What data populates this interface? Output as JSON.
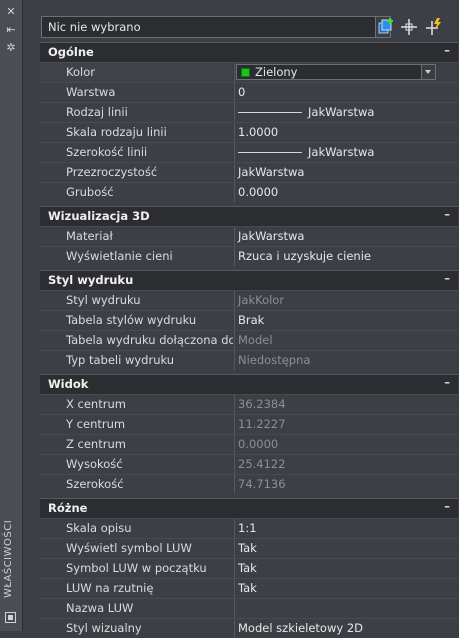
{
  "palette_title": "WŁAŚCIWOŚCI",
  "selector": {
    "value": "Nic nie wybrano"
  },
  "toolbar": {
    "icons": [
      "toggle-pickadd-icon",
      "select-objects-icon",
      "quick-select-icon"
    ]
  },
  "sections": {
    "general": {
      "title": "Ogólne",
      "toggle": "–",
      "color_label": "Kolor",
      "color_value": "Zielony",
      "color_hex": "#18c418",
      "layer_label": "Warstwa",
      "layer_value": "0",
      "linetype_label": "Rodzaj linii",
      "linetype_value": "JakWarstwa",
      "ltscale_label": "Skala rodzaju linii",
      "ltscale_value": "1.0000",
      "lineweight_label": "Szerokość linii",
      "lineweight_value": "JakWarstwa",
      "transparency_label": "Przezroczystość",
      "transparency_value": "JakWarstwa",
      "thickness_label": "Grubość",
      "thickness_value": "0.0000"
    },
    "viz3d": {
      "title": "Wizualizacja 3D",
      "toggle": "–",
      "material_label": "Materiał",
      "material_value": "JakWarstwa",
      "shadow_label": "Wyświetlanie cieni",
      "shadow_value": "Rzuca i uzyskuje cienie"
    },
    "plot": {
      "title": "Styl wydruku",
      "toggle": "–",
      "plotstyle_label": "Styl wydruku",
      "plotstyle_value": "JakKolor",
      "table_label": "Tabela stylów wydruku",
      "table_value": "Brak",
      "attached_label": "Tabela wydruku dołączona do",
      "attached_value": "Model",
      "tabletype_label": "Typ tabeli wydruku",
      "tabletype_value": "Niedostępna"
    },
    "view": {
      "title": "Widok",
      "toggle": "–",
      "cx_label": "X centrum",
      "cx_value": "36.2384",
      "cy_label": "Y centrum",
      "cy_value": "11.2227",
      "cz_label": "Z centrum",
      "cz_value": "0.0000",
      "height_label": "Wysokość",
      "height_value": "25.4122",
      "width_label": "Szerokość",
      "width_value": "74.7136"
    },
    "misc": {
      "title": "Różne",
      "toggle": "–",
      "annoscale_label": "Skala opisu",
      "annoscale_value": "1:1",
      "ucsicon_label": "Wyświetl symbol LUW",
      "ucsicon_value": "Tak",
      "ucsorigin_label": "Symbol LUW w początku",
      "ucsorigin_value": "Tak",
      "ucsvp_label": "LUW na rzutnię",
      "ucsvp_value": "Tak",
      "ucsname_label": "Nazwa LUW",
      "ucsname_value": "",
      "visualstyle_label": "Styl wizualny",
      "visualstyle_value": "Model szkieletowy 2D"
    }
  }
}
